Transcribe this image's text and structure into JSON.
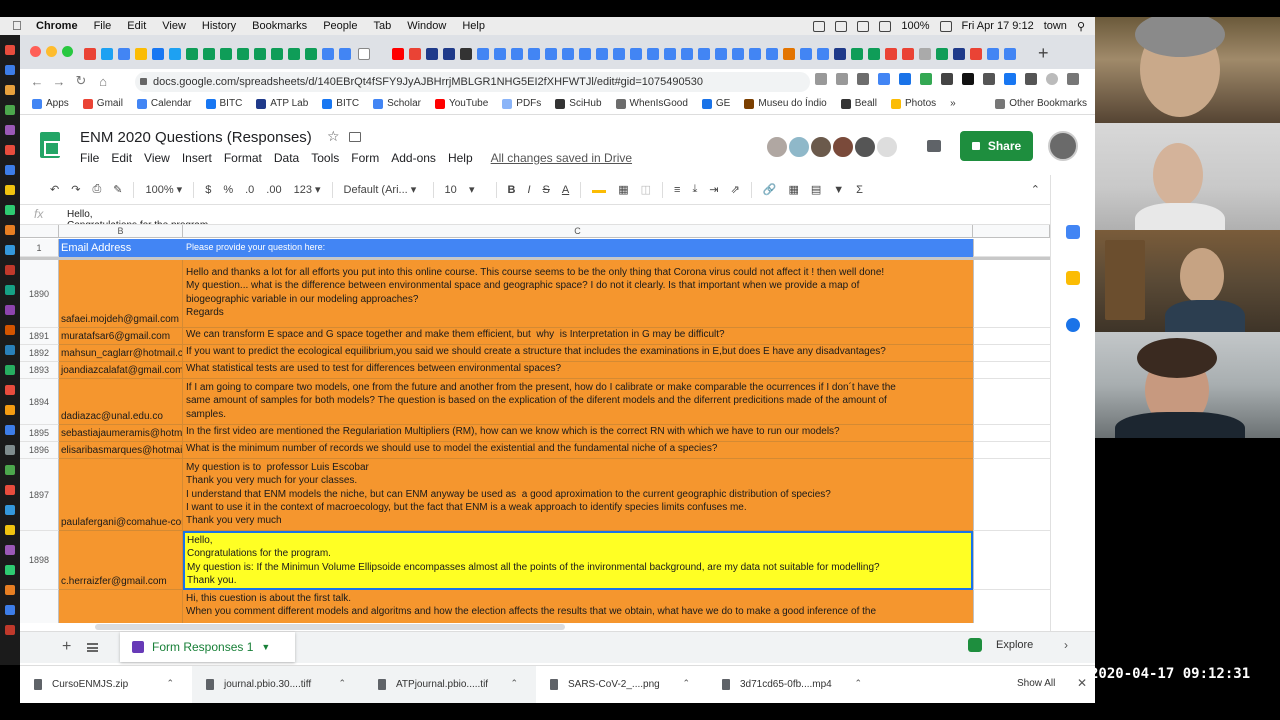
{
  "menubar": {
    "app": "Chrome",
    "items": [
      "File",
      "Edit",
      "View",
      "History",
      "Bookmarks",
      "People",
      "Tab",
      "Window",
      "Help"
    ],
    "battery": "100%",
    "datetime": "Fri Apr 17  9:12",
    "user": "town"
  },
  "browser": {
    "url": "docs.google.com/spreadsheets/d/140EBrQt4fSFY9JyAJBHrrjMBLGR1NHG5EI2fXHFWTJl/edit#gid=1075490530",
    "bookmarks": [
      {
        "label": "Apps",
        "color": "#4285f4"
      },
      {
        "label": "Gmail",
        "color": "#ea4335"
      },
      {
        "label": "Calendar",
        "color": "#4285f4"
      },
      {
        "label": "BITC",
        "color": "#1877f2"
      },
      {
        "label": "ATP Lab",
        "color": "#1f3a8a"
      },
      {
        "label": "BITC",
        "color": "#1877f2"
      },
      {
        "label": "Scholar",
        "color": "#4285f4"
      },
      {
        "label": "YouTube",
        "color": "#ff0000"
      },
      {
        "label": "PDFs",
        "color": "#8ab4f8"
      },
      {
        "label": "SciHub",
        "color": "#333333"
      },
      {
        "label": "WhenIsGood",
        "color": "#6c6c6c"
      },
      {
        "label": "GE",
        "color": "#1a73e8"
      },
      {
        "label": "Museu do Índio",
        "color": "#7b3f00"
      },
      {
        "label": "Beall",
        "color": "#333333"
      },
      {
        "label": "Photos",
        "color": "#fbbc04"
      }
    ],
    "other_bookmarks": "Other Bookmarks"
  },
  "sheets": {
    "title": "ENM 2020 Questions (Responses)",
    "menu": [
      "File",
      "Edit",
      "View",
      "Insert",
      "Format",
      "Data",
      "Tools",
      "Form",
      "Add-ons",
      "Help"
    ],
    "saved_status": "All changes saved in Drive",
    "share_label": "Share",
    "toolbar": {
      "zoom": "100%",
      "currency": "$",
      "percent": "%",
      "dec_less": ".0",
      "dec_more": ".00",
      "format_more": "123",
      "font": "Default (Ari...",
      "font_size": "10",
      "bold": "B",
      "italic": "I",
      "strike": "S",
      "text_color": "A"
    },
    "formula_bar": {
      "fx": "fx",
      "text": "Hello,\nCongratulations for the program."
    },
    "columns": [
      "B",
      "C"
    ],
    "header_row": {
      "number": "1",
      "b": "Email Address",
      "c": "Please provide your question here:"
    },
    "rows": [
      {
        "number": "1890",
        "email": "safaei.mojdeh@gmail.com",
        "question": "Hello and thanks a lot for all efforts you put into this online course. This course seems to be the only thing that Corona virus could not affect it ! then well done!\nMy question... what is the difference between environmental space and geographic space? I do not it clearly. Is that important when we provide a map of\nbiogeographic variable in our modeling approaches?\nRegards"
      },
      {
        "number": "1891",
        "email": "muratafsar6@gmail.com",
        "question": "We can transform E space and G space together and make them efficient, but  why  is Interpretation in G may be difficult?"
      },
      {
        "number": "1892",
        "email": "mahsun_caglarr@hotmail.com",
        "question": "If you want to predict the ecological equilibrium,you said we should create a structure that includes the examinations in E,but does E have any disadvantages?"
      },
      {
        "number": "1893",
        "email": "joandiazcalafat@gmail.com",
        "question": "What statistical tests are used to test for differences between environmental spaces?"
      },
      {
        "number": "1894",
        "email": "dadiazac@unal.edu.co",
        "question": "If I am going to compare two models, one from the future and another from the present, how do I calibrate or make comparable the ocurrences if I don´t have the\nsame amount of samples for both models? The question is based on the explication of the diferent models and the diferrent predicitions made of the amount of\nsamples."
      },
      {
        "number": "1895",
        "email": "sebastiajaumeramis@hotmail.com",
        "question": "In the first video are mentioned the Regulariation Multipliers (RM), how can we know which is the correct RN with which we have to run our models?"
      },
      {
        "number": "1896",
        "email": "elisaribasmarques@hotmail.com",
        "question": "What is the minimum number of records we should use to model the existential and the fundamental niche of a species?"
      },
      {
        "number": "1897",
        "email": "paulafergani@comahue-conicet.gob.ar",
        "question": "My question is to  professor Luis Escobar\nThank you very much for your classes.\nI understand that ENM models the niche, but can ENM anyway be used as  a good aproximation to the current geographic distribution of species?\nI want to use it in the context of macroecology, but the fact that ENM is a weak approach to identify species limits confuses me.\nThank you very much"
      },
      {
        "number": "1898",
        "email": "c.herraizfer@gmail.com",
        "question": "Hello,\nCongratulations for the program.\nMy question is: If the Minimun Volume Ellipsoide encompasses almost all the points of the invironmental background, are my data not suitable for modelling?\nThank you."
      },
      {
        "number": "",
        "email": "",
        "question": "Hi, this cuestion is about the first talk.\nWhen you comment different models and algoritms and how the election affects the results that we obtain, what have we do to make a good inference of the"
      }
    ],
    "sheet_tab": "Form Responses 1",
    "explore": "Explore"
  },
  "downloads": [
    {
      "name": "CursoENMJS.zip"
    },
    {
      "name": "journal.pbio.30....tiff"
    },
    {
      "name": "ATPjournal.pbio.....tif"
    },
    {
      "name": "SARS-CoV-2_....png"
    },
    {
      "name": "3d71cd65-0fb....mp4"
    }
  ],
  "show_all": "Show All",
  "timestamp": "2020-04-17 09:12:31"
}
